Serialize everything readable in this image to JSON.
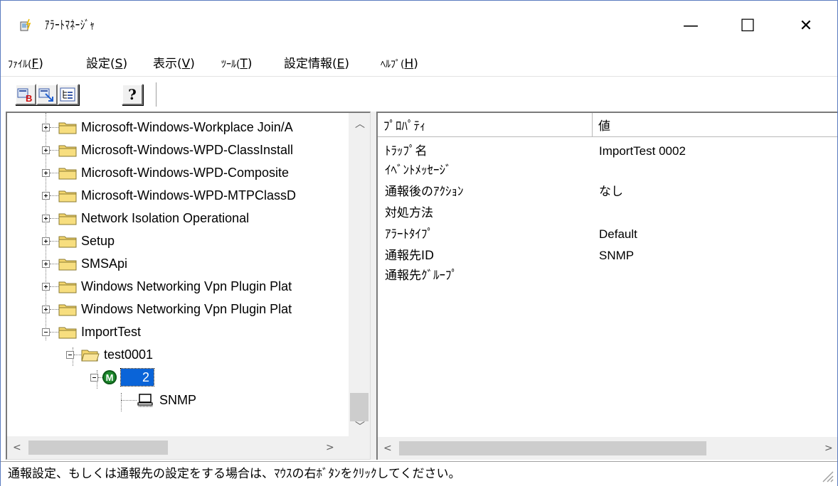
{
  "window": {
    "title": "ｱﾗｰﾄﾏﾈｰｼﾞｬ",
    "minimize_glyph": "—",
    "maximize_glyph": "☐",
    "close_glyph": "✕"
  },
  "menu": [
    {
      "label": "ﾌｧｲﾙ(",
      "key": "F",
      "suffix": ")"
    },
    {
      "label": "設定(",
      "key": "S",
      "suffix": ")"
    },
    {
      "label": "表示(",
      "key": "V",
      "suffix": ")"
    },
    {
      "label": "ﾂｰﾙ(",
      "key": "T",
      "suffix": ")"
    },
    {
      "label": "設定情報(",
      "key": "E",
      "suffix": ")"
    },
    {
      "label": "ﾍﾙﾌﾟ(",
      "key": "H",
      "suffix": ")"
    }
  ],
  "toolbar": {
    "buttons": [
      {
        "name": "monitor-b-icon"
      },
      {
        "name": "monitor-arrow-icon"
      },
      {
        "name": "tree-view-icon"
      },
      {
        "name": "help-icon",
        "glyph": "?"
      }
    ]
  },
  "tree": {
    "items": [
      {
        "label": "Microsoft-Windows-Workplace Join/A",
        "state": "collapsed"
      },
      {
        "label": "Microsoft-Windows-WPD-ClassInstall",
        "state": "collapsed"
      },
      {
        "label": "Microsoft-Windows-WPD-Composite",
        "state": "collapsed"
      },
      {
        "label": "Microsoft-Windows-WPD-MTPClassD",
        "state": "collapsed"
      },
      {
        "label": "Network Isolation Operational",
        "state": "collapsed"
      },
      {
        "label": "Setup",
        "state": "collapsed"
      },
      {
        "label": "SMSApi",
        "state": "collapsed"
      },
      {
        "label": "Windows Networking Vpn Plugin Plat",
        "state": "collapsed"
      },
      {
        "label": "Windows Networking Vpn Plugin Plat",
        "state": "collapsed"
      },
      {
        "label": "ImportTest",
        "state": "expanded"
      }
    ],
    "child_folder": "test0001",
    "monitor_node": {
      "badge": "M",
      "label": "2"
    },
    "leaf": "SNMP"
  },
  "properties": {
    "col_property": "ﾌﾟﾛﾊﾟﾃｨ",
    "col_value": "値",
    "rows": [
      {
        "name": "ﾄﾗｯﾌﾟ名",
        "value": "ImportTest 0002"
      },
      {
        "name": "ｲﾍﾞﾝﾄﾒｯｾｰｼﾞ",
        "value": ""
      },
      {
        "name": "通報後のｱｸｼｮﾝ",
        "value": "なし"
      },
      {
        "name": "対処方法",
        "value": ""
      },
      {
        "name": "ｱﾗｰﾄﾀｲﾌﾟ",
        "value": "Default"
      },
      {
        "name": "通報先ID",
        "value": "SNMP"
      },
      {
        "name": "通報先ｸﾞﾙｰﾌﾟ",
        "value": ""
      }
    ]
  },
  "status": {
    "text": "通報設定、もしくは通報先の設定をする場合は、ﾏｳｽの右ﾎﾞﾀﾝをｸﾘｯｸしてください。"
  },
  "colors": {
    "selection": "#0a64d8",
    "folder": "#f5d76e",
    "monitor_badge": "#1e8a2e"
  }
}
